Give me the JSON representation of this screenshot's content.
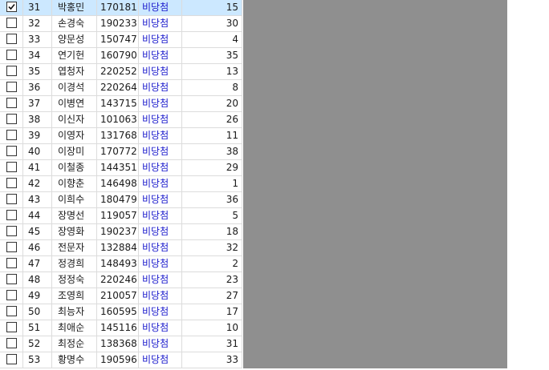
{
  "rows": [
    {
      "num": "31",
      "name": "박홍민",
      "code": "170181",
      "status": "비당첨",
      "value": "15",
      "checked": true
    },
    {
      "num": "32",
      "name": "손경숙",
      "code": "190233",
      "status": "비당첨",
      "value": "30",
      "checked": false
    },
    {
      "num": "33",
      "name": "양문성",
      "code": "150747",
      "status": "비당첨",
      "value": "4",
      "checked": false
    },
    {
      "num": "34",
      "name": "연기헌",
      "code": "160790",
      "status": "비당첨",
      "value": "35",
      "checked": false
    },
    {
      "num": "35",
      "name": "엽청자",
      "code": "220252",
      "status": "비당첨",
      "value": "13",
      "checked": false
    },
    {
      "num": "36",
      "name": "이경석",
      "code": "220264",
      "status": "비당첨",
      "value": "8",
      "checked": false
    },
    {
      "num": "37",
      "name": "이병연",
      "code": "143715",
      "status": "비당첨",
      "value": "20",
      "checked": false
    },
    {
      "num": "38",
      "name": "이신자",
      "code": "101063",
      "status": "비당첨",
      "value": "26",
      "checked": false
    },
    {
      "num": "39",
      "name": "이영자",
      "code": "131768",
      "status": "비당첨",
      "value": "11",
      "checked": false
    },
    {
      "num": "40",
      "name": "이장미",
      "code": "170772",
      "status": "비당첨",
      "value": "38",
      "checked": false
    },
    {
      "num": "41",
      "name": "이철종",
      "code": "144351",
      "status": "비당첨",
      "value": "29",
      "checked": false
    },
    {
      "num": "42",
      "name": "이향춘",
      "code": "146498",
      "status": "비당첨",
      "value": "1",
      "checked": false
    },
    {
      "num": "43",
      "name": "이희수",
      "code": "180479",
      "status": "비당첨",
      "value": "36",
      "checked": false
    },
    {
      "num": "44",
      "name": "장명선",
      "code": "119057",
      "status": "비당첨",
      "value": "5",
      "checked": false
    },
    {
      "num": "45",
      "name": "장영화",
      "code": "190237",
      "status": "비당첨",
      "value": "18",
      "checked": false
    },
    {
      "num": "46",
      "name": "전문자",
      "code": "132884",
      "status": "비당첨",
      "value": "32",
      "checked": false
    },
    {
      "num": "47",
      "name": "정경희",
      "code": "148493",
      "status": "비당첨",
      "value": "2",
      "checked": false
    },
    {
      "num": "48",
      "name": "정정숙",
      "code": "220246",
      "status": "비당첨",
      "value": "23",
      "checked": false
    },
    {
      "num": "49",
      "name": "조영희",
      "code": "210057",
      "status": "비당첨",
      "value": "27",
      "checked": false
    },
    {
      "num": "50",
      "name": "최능자",
      "code": "160595",
      "status": "비당첨",
      "value": "17",
      "checked": false
    },
    {
      "num": "51",
      "name": "최애순",
      "code": "145116",
      "status": "비당첨",
      "value": "10",
      "checked": false
    },
    {
      "num": "52",
      "name": "최정순",
      "code": "138368",
      "status": "비당첨",
      "value": "31",
      "checked": false
    },
    {
      "num": "53",
      "name": "황명수",
      "code": "190596",
      "status": "비당첨",
      "value": "33",
      "checked": false
    }
  ]
}
